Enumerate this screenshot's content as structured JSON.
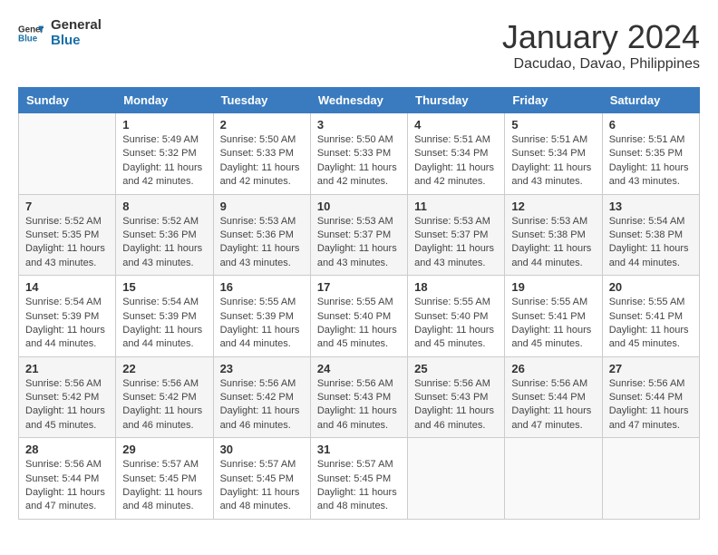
{
  "header": {
    "logo_line1": "General",
    "logo_line2": "Blue",
    "month": "January 2024",
    "location": "Dacudao, Davao, Philippines"
  },
  "weekdays": [
    "Sunday",
    "Monday",
    "Tuesday",
    "Wednesday",
    "Thursday",
    "Friday",
    "Saturday"
  ],
  "weeks": [
    [
      {
        "day": "",
        "sunrise": "",
        "sunset": "",
        "daylight": ""
      },
      {
        "day": "1",
        "sunrise": "Sunrise: 5:49 AM",
        "sunset": "Sunset: 5:32 PM",
        "daylight": "Daylight: 11 hours and 42 minutes."
      },
      {
        "day": "2",
        "sunrise": "Sunrise: 5:50 AM",
        "sunset": "Sunset: 5:33 PM",
        "daylight": "Daylight: 11 hours and 42 minutes."
      },
      {
        "day": "3",
        "sunrise": "Sunrise: 5:50 AM",
        "sunset": "Sunset: 5:33 PM",
        "daylight": "Daylight: 11 hours and 42 minutes."
      },
      {
        "day": "4",
        "sunrise": "Sunrise: 5:51 AM",
        "sunset": "Sunset: 5:34 PM",
        "daylight": "Daylight: 11 hours and 42 minutes."
      },
      {
        "day": "5",
        "sunrise": "Sunrise: 5:51 AM",
        "sunset": "Sunset: 5:34 PM",
        "daylight": "Daylight: 11 hours and 43 minutes."
      },
      {
        "day": "6",
        "sunrise": "Sunrise: 5:51 AM",
        "sunset": "Sunset: 5:35 PM",
        "daylight": "Daylight: 11 hours and 43 minutes."
      }
    ],
    [
      {
        "day": "7",
        "sunrise": "Sunrise: 5:52 AM",
        "sunset": "Sunset: 5:35 PM",
        "daylight": "Daylight: 11 hours and 43 minutes."
      },
      {
        "day": "8",
        "sunrise": "Sunrise: 5:52 AM",
        "sunset": "Sunset: 5:36 PM",
        "daylight": "Daylight: 11 hours and 43 minutes."
      },
      {
        "day": "9",
        "sunrise": "Sunrise: 5:53 AM",
        "sunset": "Sunset: 5:36 PM",
        "daylight": "Daylight: 11 hours and 43 minutes."
      },
      {
        "day": "10",
        "sunrise": "Sunrise: 5:53 AM",
        "sunset": "Sunset: 5:37 PM",
        "daylight": "Daylight: 11 hours and 43 minutes."
      },
      {
        "day": "11",
        "sunrise": "Sunrise: 5:53 AM",
        "sunset": "Sunset: 5:37 PM",
        "daylight": "Daylight: 11 hours and 43 minutes."
      },
      {
        "day": "12",
        "sunrise": "Sunrise: 5:53 AM",
        "sunset": "Sunset: 5:38 PM",
        "daylight": "Daylight: 11 hours and 44 minutes."
      },
      {
        "day": "13",
        "sunrise": "Sunrise: 5:54 AM",
        "sunset": "Sunset: 5:38 PM",
        "daylight": "Daylight: 11 hours and 44 minutes."
      }
    ],
    [
      {
        "day": "14",
        "sunrise": "Sunrise: 5:54 AM",
        "sunset": "Sunset: 5:39 PM",
        "daylight": "Daylight: 11 hours and 44 minutes."
      },
      {
        "day": "15",
        "sunrise": "Sunrise: 5:54 AM",
        "sunset": "Sunset: 5:39 PM",
        "daylight": "Daylight: 11 hours and 44 minutes."
      },
      {
        "day": "16",
        "sunrise": "Sunrise: 5:55 AM",
        "sunset": "Sunset: 5:39 PM",
        "daylight": "Daylight: 11 hours and 44 minutes."
      },
      {
        "day": "17",
        "sunrise": "Sunrise: 5:55 AM",
        "sunset": "Sunset: 5:40 PM",
        "daylight": "Daylight: 11 hours and 45 minutes."
      },
      {
        "day": "18",
        "sunrise": "Sunrise: 5:55 AM",
        "sunset": "Sunset: 5:40 PM",
        "daylight": "Daylight: 11 hours and 45 minutes."
      },
      {
        "day": "19",
        "sunrise": "Sunrise: 5:55 AM",
        "sunset": "Sunset: 5:41 PM",
        "daylight": "Daylight: 11 hours and 45 minutes."
      },
      {
        "day": "20",
        "sunrise": "Sunrise: 5:55 AM",
        "sunset": "Sunset: 5:41 PM",
        "daylight": "Daylight: 11 hours and 45 minutes."
      }
    ],
    [
      {
        "day": "21",
        "sunrise": "Sunrise: 5:56 AM",
        "sunset": "Sunset: 5:42 PM",
        "daylight": "Daylight: 11 hours and 45 minutes."
      },
      {
        "day": "22",
        "sunrise": "Sunrise: 5:56 AM",
        "sunset": "Sunset: 5:42 PM",
        "daylight": "Daylight: 11 hours and 46 minutes."
      },
      {
        "day": "23",
        "sunrise": "Sunrise: 5:56 AM",
        "sunset": "Sunset: 5:42 PM",
        "daylight": "Daylight: 11 hours and 46 minutes."
      },
      {
        "day": "24",
        "sunrise": "Sunrise: 5:56 AM",
        "sunset": "Sunset: 5:43 PM",
        "daylight": "Daylight: 11 hours and 46 minutes."
      },
      {
        "day": "25",
        "sunrise": "Sunrise: 5:56 AM",
        "sunset": "Sunset: 5:43 PM",
        "daylight": "Daylight: 11 hours and 46 minutes."
      },
      {
        "day": "26",
        "sunrise": "Sunrise: 5:56 AM",
        "sunset": "Sunset: 5:44 PM",
        "daylight": "Daylight: 11 hours and 47 minutes."
      },
      {
        "day": "27",
        "sunrise": "Sunrise: 5:56 AM",
        "sunset": "Sunset: 5:44 PM",
        "daylight": "Daylight: 11 hours and 47 minutes."
      }
    ],
    [
      {
        "day": "28",
        "sunrise": "Sunrise: 5:56 AM",
        "sunset": "Sunset: 5:44 PM",
        "daylight": "Daylight: 11 hours and 47 minutes."
      },
      {
        "day": "29",
        "sunrise": "Sunrise: 5:57 AM",
        "sunset": "Sunset: 5:45 PM",
        "daylight": "Daylight: 11 hours and 48 minutes."
      },
      {
        "day": "30",
        "sunrise": "Sunrise: 5:57 AM",
        "sunset": "Sunset: 5:45 PM",
        "daylight": "Daylight: 11 hours and 48 minutes."
      },
      {
        "day": "31",
        "sunrise": "Sunrise: 5:57 AM",
        "sunset": "Sunset: 5:45 PM",
        "daylight": "Daylight: 11 hours and 48 minutes."
      },
      {
        "day": "",
        "sunrise": "",
        "sunset": "",
        "daylight": ""
      },
      {
        "day": "",
        "sunrise": "",
        "sunset": "",
        "daylight": ""
      },
      {
        "day": "",
        "sunrise": "",
        "sunset": "",
        "daylight": ""
      }
    ]
  ]
}
